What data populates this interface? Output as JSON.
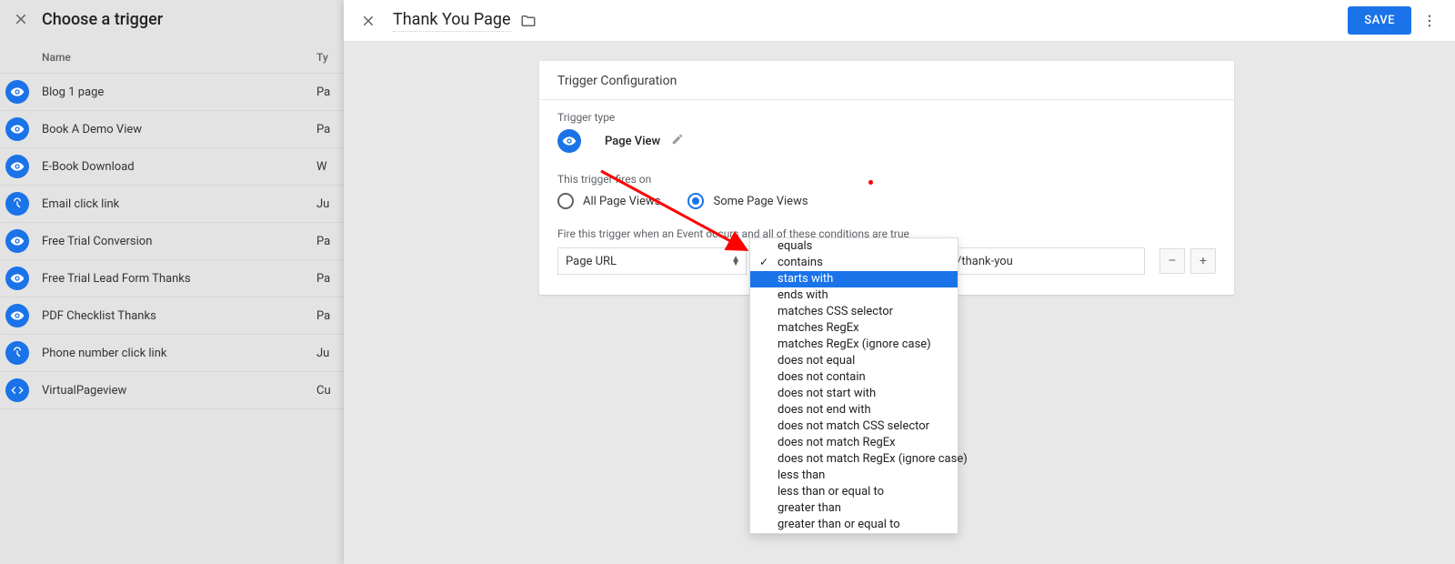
{
  "left": {
    "title": "Choose a trigger",
    "columns": {
      "name": "Name",
      "type": "Ty"
    },
    "rows": [
      {
        "icon": "eye",
        "name": "Blog 1 page",
        "type": "Pa"
      },
      {
        "icon": "eye",
        "name": "Book A Demo View",
        "type": "Pa"
      },
      {
        "icon": "eye",
        "name": "E-Book Download",
        "type": "W"
      },
      {
        "icon": "click",
        "name": "Email click link",
        "type": "Ju"
      },
      {
        "icon": "eye",
        "name": "Free Trial Conversion",
        "type": "Pa"
      },
      {
        "icon": "eye",
        "name": "Free Trial Lead Form Thanks",
        "type": "Pa"
      },
      {
        "icon": "eye",
        "name": "PDF Checklist Thanks",
        "type": "Pa"
      },
      {
        "icon": "click",
        "name": "Phone number click link",
        "type": "Ju"
      },
      {
        "icon": "code",
        "name": "VirtualPageview",
        "type": "Cu"
      }
    ]
  },
  "editor": {
    "title": "Thank You Page",
    "save_label": "SAVE",
    "card_title": "Trigger Configuration",
    "trigger_type_label": "Trigger type",
    "trigger_type_name": "Page View",
    "fires_on_label": "This trigger fires on",
    "radio_all": "All Page Views",
    "radio_some": "Some Page Views",
    "cond_label": "Fire this trigger when an Event occurs and all of these conditions are true",
    "cond_variable": "Page URL",
    "cond_value": "/thank-you",
    "minus": "–",
    "plus": "+"
  },
  "dropdown": {
    "selected": "contains",
    "highlighted": "starts with",
    "options": [
      "equals",
      "contains",
      "starts with",
      "ends with",
      "matches CSS selector",
      "matches RegEx",
      "matches RegEx (ignore case)",
      "does not equal",
      "does not contain",
      "does not start with",
      "does not end with",
      "does not match CSS selector",
      "does not match RegEx",
      "does not match RegEx (ignore case)",
      "less than",
      "less than or equal to",
      "greater than",
      "greater than or equal to"
    ]
  }
}
